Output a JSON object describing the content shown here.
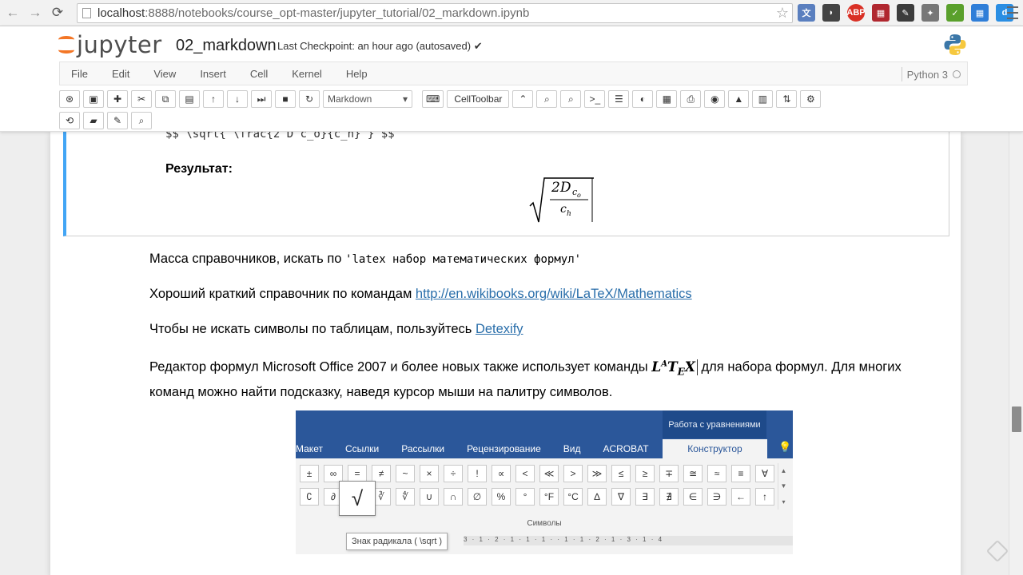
{
  "browser": {
    "url_host": "localhost",
    "url_rest": ":8888/notebooks/course_opt-master/jupyter_tutorial/02_markdown.ipynb"
  },
  "header": {
    "logo_text": "jupyter",
    "notebook_name": "02_markdown",
    "checkpoint": "Last Checkpoint: an hour ago (autosaved) ✔",
    "kernel_name": "Python 3"
  },
  "menu": {
    "items": [
      "File",
      "Edit",
      "View",
      "Insert",
      "Cell",
      "Kernel",
      "Help"
    ]
  },
  "toolbar": {
    "cell_type": "Markdown",
    "celltoolbar_label": "CellToolbar"
  },
  "cell": {
    "code_line": "$$ \\sqrt{ \\frac{2 D c_o}{c_n} } $$",
    "result_label": "Результат:"
  },
  "content": {
    "p1_text": "Масса справочников, искать по ",
    "p1_code": "'latex набор математических формул'",
    "p2_text": "Хороший краткий справочник по командам ",
    "p2_link": "http://en.wikibooks.org/wiki/LaTeX/Mathematics",
    "p3_text": "Чтобы не искать символы по таблицам, пользуйтесь ",
    "p3_link": "Detexify",
    "p4_text_a": "Редактор формул Microsoft Office 2007 и более новых также использует команды ",
    "p4_text_b": " для набора формул. Для многих команд можно найти подсказку, наведя курсор мыши на палитру символов."
  },
  "ribbon": {
    "context_title": "Работа с уравнениями",
    "tabs": [
      "Макет",
      "Ссылки",
      "Рассылки",
      "Рецензирование",
      "Вид",
      "ACROBAT"
    ],
    "active_tab": "Конструктор",
    "row1": [
      "±",
      "∞",
      "=",
      "≠",
      "~",
      "×",
      "÷",
      "!",
      "∝",
      "<",
      "≪",
      ">",
      "≫",
      "≤",
      "≥",
      "∓",
      "≅",
      "≈",
      "≡",
      "∀"
    ],
    "row2": [
      "∁",
      "∂",
      "√",
      "∛",
      "∜",
      "∪",
      "∩",
      "∅",
      "%",
      "°",
      "°F",
      "°C",
      "∆",
      "∇",
      "∃",
      "∄",
      "∈",
      "∋",
      "←",
      "↑"
    ],
    "big_symbol": "√",
    "group_label": "Символы",
    "tooltip": "Знак радикала ( \\sqrt )",
    "ruler": "3 · 1 · 2 · 1 · 1 · 1 ·  · 1 · 1 · 2 · 1 · 3 · 1 · 4"
  },
  "colors": {
    "accent_selected": "#42a5f5",
    "link": "#296eaa",
    "ribbon_blue": "#2b579a",
    "jupyter_orange": "#f37626"
  }
}
